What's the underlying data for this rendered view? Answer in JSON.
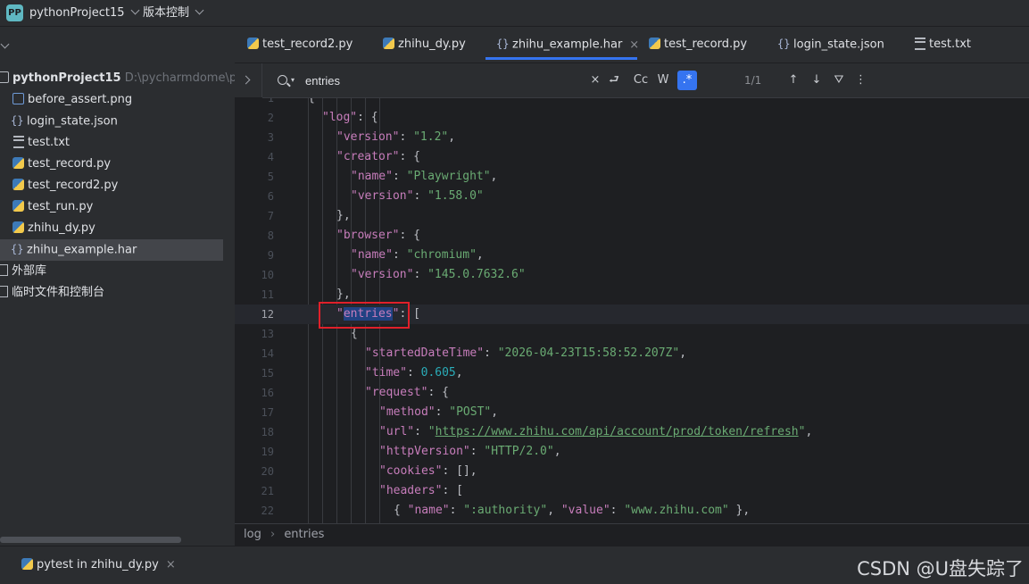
{
  "titlebar": {
    "badge": "PP",
    "project_name": "pythonProject15",
    "vcs_menu": "版本控制"
  },
  "sidebar": {
    "project_root": "pythonProject15",
    "project_path": "D:\\pycharmdome\\python",
    "files": [
      {
        "name": "before_assert.png",
        "icon": "image-icon"
      },
      {
        "name": "login_state.json",
        "icon": "json-icon"
      },
      {
        "name": "test.txt",
        "icon": "text-icon"
      },
      {
        "name": "test_record.py",
        "icon": "python-icon"
      },
      {
        "name": "test_record2.py",
        "icon": "python-icon"
      },
      {
        "name": "test_run.py",
        "icon": "python-icon"
      },
      {
        "name": "zhihu_dy.py",
        "icon": "python-icon"
      },
      {
        "name": "zhihu_example.har",
        "icon": "json-icon",
        "selected": true
      }
    ],
    "external_libraries": "外部库",
    "scratches": "临时文件和控制台"
  },
  "tabs": [
    {
      "label": "test_record2.py",
      "icon": "python-icon"
    },
    {
      "label": "zhihu_dy.py",
      "icon": "python-icon"
    },
    {
      "label": "zhihu_example.har",
      "icon": "json-icon",
      "active": true
    },
    {
      "label": "test_record.py",
      "icon": "python-icon"
    },
    {
      "label": "login_state.json",
      "icon": "json-icon"
    },
    {
      "label": "test.txt",
      "icon": "text-icon"
    }
  ],
  "search": {
    "query": "entries",
    "case_label": "Cc",
    "word_label": "W",
    "regex_label": ".*",
    "match_count": "1/1"
  },
  "code": {
    "current_line": 12,
    "lines": [
      {
        "n": "1",
        "text": "{"
      },
      {
        "n": "2",
        "text": "\"log\": {"
      },
      {
        "n": "3",
        "text": "\"version\": \"1.2\","
      },
      {
        "n": "4",
        "text": "\"creator\": {"
      },
      {
        "n": "5",
        "text": "\"name\": \"Playwright\","
      },
      {
        "n": "6",
        "text": "\"version\": \"1.58.0\""
      },
      {
        "n": "7",
        "text": "},"
      },
      {
        "n": "8",
        "text": "\"browser\": {"
      },
      {
        "n": "9",
        "text": "\"name\": \"chromium\","
      },
      {
        "n": "10",
        "text": "\"version\": \"145.0.7632.6\""
      },
      {
        "n": "11",
        "text": "},"
      },
      {
        "n": "12",
        "text": "\"entries\": ["
      },
      {
        "n": "13",
        "text": "{"
      },
      {
        "n": "14",
        "text": "\"startedDateTime\": \"2026-04-23T15:58:52.207Z\","
      },
      {
        "n": "15",
        "text": "\"time\": 0.605,"
      },
      {
        "n": "16",
        "text": "\"request\": {"
      },
      {
        "n": "17",
        "text": "\"method\": \"POST\","
      },
      {
        "n": "18",
        "text": "\"url\": \"https://www.zhihu.com/api/account/prod/token/refresh\","
      },
      {
        "n": "19",
        "text": "\"httpVersion\": \"HTTP/2.0\","
      },
      {
        "n": "20",
        "text": "\"cookies\": [],"
      },
      {
        "n": "21",
        "text": "\"headers\": ["
      },
      {
        "n": "22",
        "text": "{ \"name\": \":authority\", \"value\": \"www.zhihu.com\" },"
      }
    ]
  },
  "breadcrumb": {
    "items": [
      "log",
      "entries"
    ],
    "separator": "›"
  },
  "bottom": {
    "run_tab": "pytest in zhihu_dy.py",
    "close": "×"
  },
  "watermark": "CSDN @U盘失踪了"
}
